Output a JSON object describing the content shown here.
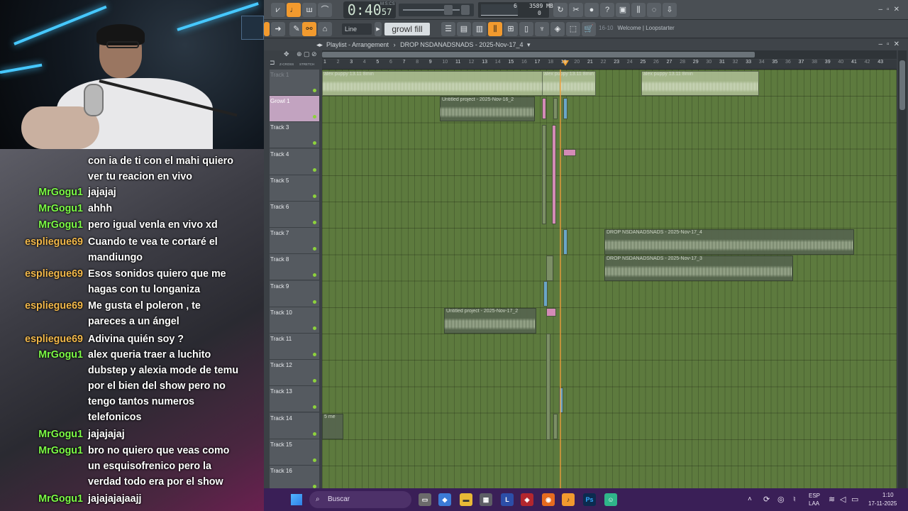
{
  "fl": {
    "transport": {
      "time_main": "0:40",
      "time_frac": "57",
      "time_label": "M:S:CS"
    },
    "cpu": {
      "memory": "3589 MB",
      "cores": "6",
      "zero": "0"
    },
    "toolbar": {
      "snap": "Line",
      "pattern": "growl fill",
      "hint_num": "16-10",
      "hint_text": "Welcome | Loopstarter"
    },
    "playlist": {
      "title": "Playlist - Arrangement",
      "sep": "›",
      "arrangement": "DROP NSDANADSNADS - 2025-Nov-17_4",
      "chevron": "▾",
      "cross_label": "Z-CROSS",
      "stretch_label": "STRETCH"
    },
    "ruler_ticks": [
      "1",
      "2",
      "3",
      "4",
      "5",
      "6",
      "7",
      "8",
      "9",
      "10",
      "11",
      "12",
      "13",
      "14",
      "15",
      "16",
      "17",
      "18",
      "19",
      "20",
      "21",
      "22",
      "23",
      "24",
      "25",
      "26",
      "27",
      "28",
      "29",
      "30",
      "31",
      "32",
      "33",
      "34",
      "35",
      "36",
      "37",
      "38",
      "39",
      "40",
      "41",
      "42",
      "43"
    ],
    "tracks": [
      "Track 1",
      "Growl 1",
      "Track 3",
      "Track 4",
      "Track 5",
      "Track 6",
      "Track 7",
      "Track 8",
      "Track 9",
      "Track 10",
      "Track 11",
      "Track 12",
      "Track 13",
      "Track 14",
      "Track 15",
      "Track 16"
    ],
    "clips": {
      "alex1": "alex puppy 13.11 8min",
      "alex2": "alex puppy 13.11 8min",
      "alex3": "alex puppy 13.11 8min",
      "untitled_nov16": "Untitled project - 2025-Nov-16_2",
      "drop_nov17_4": "DROP NSDANADSNADS - 2025-Nov-17_4",
      "drop_nov17_3": "DROP NSDANADSNADS - 2025-Nov-17_3",
      "untitled_nov17": "Untitled project - 2025-Nov-17_2",
      "me_clip": "5 me"
    }
  },
  "chat": [
    {
      "user": "",
      "user_color": "",
      "text": "con ia de ti con el mahi quiero ver tu reacion en vivo"
    },
    {
      "user": "MrGogu1",
      "user_color": "green",
      "text": "jajajaj"
    },
    {
      "user": "MrGogu1",
      "user_color": "green",
      "text": "ahhh"
    },
    {
      "user": "MrGogu1",
      "user_color": "green",
      "text": "pero igual venla en vivo xd"
    },
    {
      "user": "espliegue69",
      "user_color": "yellow",
      "text": "Cuando te vea te cortaré el mandiungo"
    },
    {
      "user": "espliegue69",
      "user_color": "yellow",
      "text": "Esos sonidos quiero que me hagas con tu longaniza"
    },
    {
      "user": "espliegue69",
      "user_color": "yellow",
      "text": "Me gusta el poleron , te pareces a un ángel"
    },
    {
      "user": "espliegue69",
      "user_color": "yellow",
      "text": "Adivina quién soy ?"
    },
    {
      "user": "MrGogu1",
      "user_color": "green",
      "text": "alex queria traer a luchito dubstep y alexia mode de temu por el bien del show pero no tengo tantos numeros telefonicos"
    },
    {
      "user": "MrGogu1",
      "user_color": "green",
      "text": "jajajajaj"
    },
    {
      "user": "MrGogu1",
      "user_color": "green",
      "text": "bro no quiero que veas como un esquisofrenico pero la verdad todo era por el show"
    },
    {
      "user": "MrGogu1",
      "user_color": "green",
      "text": "jajajajajaajj"
    }
  ],
  "taskbar": {
    "search_placeholder": "Buscar",
    "lang1": "ESP",
    "lang2": "LAA",
    "time": "1:10",
    "date": "17-11-2025"
  },
  "colors": {
    "green_user": "#7cfb46",
    "yellow_user": "#f2b84a",
    "accent": "#f29a2e",
    "playlist_bg": "#5d7a3e"
  }
}
